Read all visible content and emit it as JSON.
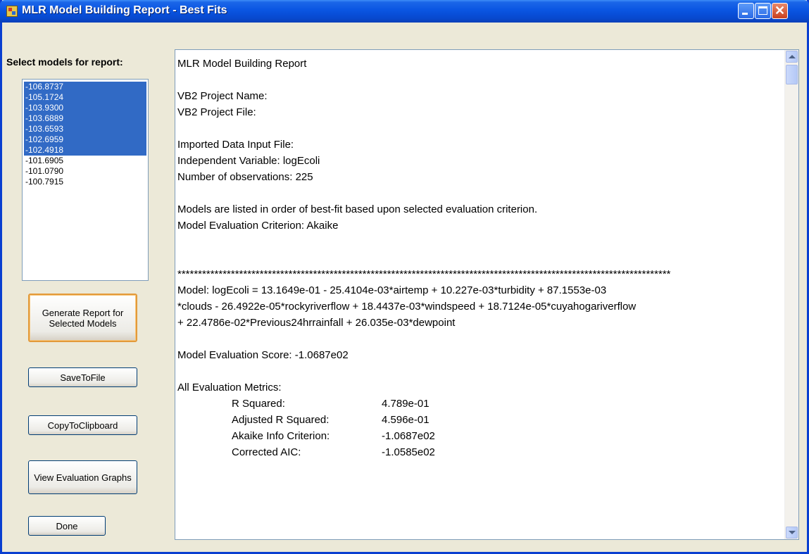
{
  "window": {
    "title": "MLR Model Building Report - Best Fits"
  },
  "left": {
    "label": "Select models for report:",
    "models": [
      {
        "value": "-106.8737",
        "selected": true
      },
      {
        "value": "-105.1724",
        "selected": true
      },
      {
        "value": "-103.9300",
        "selected": true
      },
      {
        "value": "-103.6889",
        "selected": true
      },
      {
        "value": "-103.6593",
        "selected": true
      },
      {
        "value": "-102.6959",
        "selected": true
      },
      {
        "value": "-102.4918",
        "selected": true
      },
      {
        "value": "-101.6905",
        "selected": false
      },
      {
        "value": "-101.0790",
        "selected": false
      },
      {
        "value": "-100.7915",
        "selected": false
      }
    ]
  },
  "buttons": {
    "generate": "Generate Report for Selected Models",
    "save": "SaveToFile",
    "copy": "CopyToClipboard",
    "graphs": "View Evaluation Graphs",
    "done": "Done"
  },
  "report": {
    "title": "MLR Model Building Report",
    "project_name": "VB2 Project Name:",
    "project_file": "VB2 Project File:",
    "input_file": "Imported Data Input File:",
    "independent_variable": "Independent Variable: logEcoli",
    "observations": "Number of observations: 225",
    "ordering_note": "Models are listed in order of best-fit based upon selected evaluation criterion.",
    "criterion": "Model Evaluation Criterion: Akaike",
    "separator": "************************************************************************************************************************",
    "model_line1": "Model: logEcoli = 13.1649e-01 - 25.4104e-03*airtemp + 10.227e-03*turbidity + 87.1553e-03",
    "model_line2": "*clouds - 26.4922e-05*rockyriverflow + 18.4437e-03*windspeed + 18.7124e-05*cuyahogariverflow",
    "model_line3": "+ 22.4786e-02*Previous24hrrainfall + 26.035e-03*dewpoint",
    "score": "Model Evaluation Score: -1.0687e02",
    "metrics_heading": "All Evaluation Metrics:",
    "metrics": [
      {
        "name": "R Squared:",
        "value": "4.789e-01"
      },
      {
        "name": "Adjusted R Squared:",
        "value": "4.596e-01"
      },
      {
        "name": "Akaike Info Criterion:",
        "value": "-1.0687e02"
      },
      {
        "name": "Corrected AIC:",
        "value": "-1.0585e02"
      }
    ]
  }
}
